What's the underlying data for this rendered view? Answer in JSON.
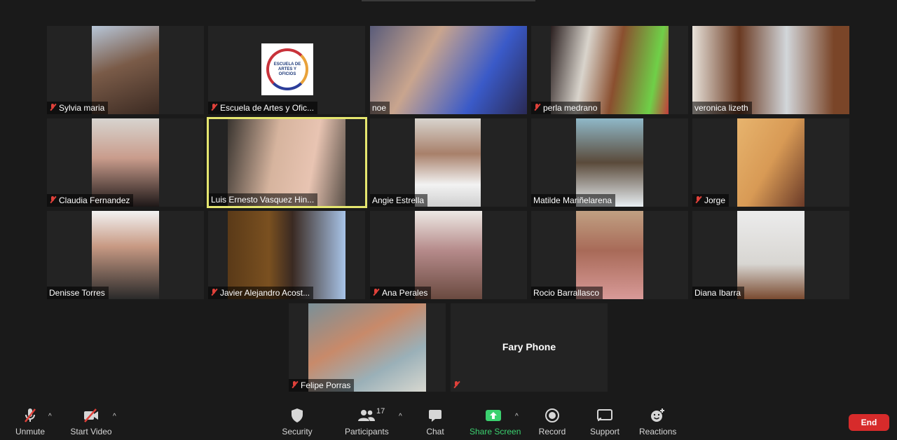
{
  "participants": [
    {
      "name": "Sylvia maria",
      "muted": true
    },
    {
      "name": "Escuela de Artes y Ofic...",
      "muted": true
    },
    {
      "name": "noe",
      "muted": false
    },
    {
      "name": "perla medrano",
      "muted": true
    },
    {
      "name": "veronica lizeth",
      "muted": false
    },
    {
      "name": "Claudia Fernandez",
      "muted": true
    },
    {
      "name": "Luis Ernesto Vasquez Hin...",
      "muted": false
    },
    {
      "name": "Angie Estrella",
      "muted": false
    },
    {
      "name": "Matilde Mariñelarena",
      "muted": false
    },
    {
      "name": "Jorge",
      "muted": true
    },
    {
      "name": "Denisse Torres",
      "muted": false
    },
    {
      "name": "Javier Alejandro Acost...",
      "muted": true
    },
    {
      "name": "Ana Perales",
      "muted": true
    },
    {
      "name": "Rocio Barrallasco",
      "muted": false
    },
    {
      "name": "Diana Ibarra",
      "muted": false
    },
    {
      "name": "Felipe Porras",
      "muted": true
    },
    {
      "name": "",
      "muted": true
    }
  ],
  "no_video_name": "Fary  Phone",
  "logo_text": "ESCUELA DE ARTES Y OFICIOS",
  "toolbar": {
    "unmute": "Unmute",
    "start_video": "Start Video",
    "security": "Security",
    "participants": "Participants",
    "participants_count": "17",
    "chat": "Chat",
    "share_screen": "Share Screen",
    "record": "Record",
    "support": "Support",
    "reactions": "Reactions",
    "end": "End"
  },
  "colors": {
    "active_speaker_border": "#e5e66f",
    "end_button": "#d72b2b",
    "share_green": "#3bd16f",
    "mute_red": "#e0413a"
  }
}
